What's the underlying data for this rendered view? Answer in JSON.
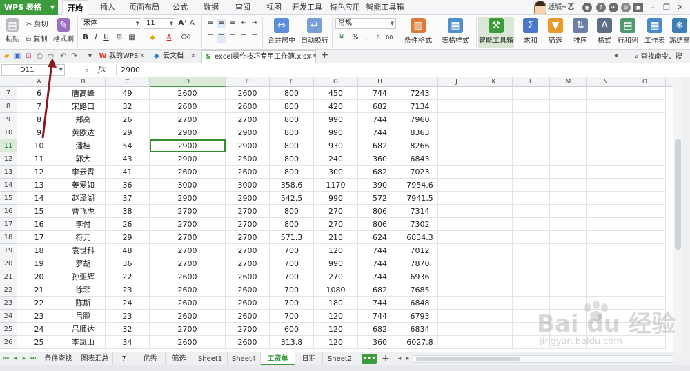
{
  "app": {
    "name": "WPS 表格"
  },
  "menu": [
    "开始",
    "插入",
    "页面布局",
    "公式",
    "数据",
    "审阅",
    "视图",
    "开发工具",
    "特色应用",
    "智能工具箱"
  ],
  "active_menu": 0,
  "user": {
    "name": "迷城~恋"
  },
  "ribbon": {
    "paste": "粘贴",
    "cut": "剪切",
    "copy": "复制",
    "format_painter": "格式刷",
    "font_name": "宋体",
    "font_size": "11",
    "merge_center": "合并居中",
    "wrap_text": "自动换行",
    "number_format": "常规",
    "cond_format": "条件格式",
    "table_style": "表格样式",
    "smart_toolbox": "智能工具箱",
    "sum": "求和",
    "filter": "筛选",
    "sort": "排序",
    "format": "格式",
    "row_col": "行和列",
    "worksheet": "工作表",
    "freeze": "冻结窗"
  },
  "tabs": [
    {
      "label": "我的WPS",
      "icon": "W",
      "color": "#d23b2f"
    },
    {
      "label": "云文档",
      "icon": "◆",
      "color": "#2f7fd2"
    },
    {
      "label": "excel操作技巧专用工作簿.xlsx *",
      "icon": "S",
      "color": "#3d9a3d"
    }
  ],
  "command_search": "查找命令、搜",
  "name_box": "D11",
  "formula": "2900",
  "columns": [
    "A",
    "B",
    "C",
    "D",
    "E",
    "F",
    "G",
    "H",
    "I",
    "J",
    "K",
    "L",
    "M",
    "N",
    "O"
  ],
  "selected_column": "D",
  "selected_row": "11",
  "rows": [
    {
      "r": "7",
      "cells": [
        "6",
        "唐高峰",
        "49",
        "2600",
        "2600",
        "800",
        "450",
        "744",
        "7243"
      ]
    },
    {
      "r": "8",
      "cells": [
        "7",
        "宋路口",
        "32",
        "2600",
        "2600",
        "800",
        "420",
        "682",
        "7134"
      ]
    },
    {
      "r": "9",
      "cells": [
        "8",
        "郑高",
        "26",
        "2700",
        "2700",
        "800",
        "990",
        "744",
        "7960"
      ]
    },
    {
      "r": "10",
      "cells": [
        "9",
        "黄欧达",
        "29",
        "2900",
        "2900",
        "800",
        "990",
        "744",
        "8363"
      ]
    },
    {
      "r": "11",
      "cells": [
        "10",
        "潘桂",
        "54",
        "2900",
        "2900",
        "800",
        "930",
        "682",
        "8266"
      ]
    },
    {
      "r": "12",
      "cells": [
        "11",
        "郭大",
        "43",
        "2900",
        "2500",
        "800",
        "240",
        "360",
        "6843"
      ]
    },
    {
      "r": "13",
      "cells": [
        "12",
        "李云霄",
        "41",
        "2600",
        "2600",
        "800",
        "300",
        "682",
        "7023"
      ]
    },
    {
      "r": "14",
      "cells": [
        "13",
        "姜爱如",
        "36",
        "3000",
        "3000",
        "358.6",
        "1170",
        "390",
        "7954.6"
      ]
    },
    {
      "r": "15",
      "cells": [
        "14",
        "赵泽湖",
        "37",
        "2900",
        "2900",
        "542.5",
        "990",
        "572",
        "7941.5"
      ]
    },
    {
      "r": "16",
      "cells": [
        "15",
        "曹飞虎",
        "38",
        "2700",
        "2700",
        "800",
        "270",
        "806",
        "7314"
      ]
    },
    {
      "r": "17",
      "cells": [
        "16",
        "李付",
        "26",
        "2700",
        "2700",
        "800",
        "270",
        "806",
        "7302"
      ]
    },
    {
      "r": "18",
      "cells": [
        "17",
        "符元",
        "29",
        "2700",
        "2700",
        "571.3",
        "210",
        "624",
        "6834.3"
      ]
    },
    {
      "r": "19",
      "cells": [
        "18",
        "袁世科",
        "48",
        "2700",
        "2700",
        "700",
        "120",
        "744",
        "7012"
      ]
    },
    {
      "r": "20",
      "cells": [
        "19",
        "罗胡",
        "36",
        "2700",
        "2700",
        "700",
        "990",
        "744",
        "7870"
      ]
    },
    {
      "r": "21",
      "cells": [
        "20",
        "孙亚辉",
        "22",
        "2600",
        "2600",
        "700",
        "270",
        "744",
        "6936"
      ]
    },
    {
      "r": "22",
      "cells": [
        "21",
        "徐菲",
        "23",
        "2600",
        "2600",
        "700",
        "1080",
        "682",
        "7685"
      ]
    },
    {
      "r": "23",
      "cells": [
        "22",
        "陈斯",
        "24",
        "2600",
        "2600",
        "700",
        "180",
        "744",
        "6848"
      ]
    },
    {
      "r": "24",
      "cells": [
        "23",
        "吕鹏",
        "23",
        "2600",
        "2600",
        "700",
        "120",
        "744",
        "6793"
      ]
    },
    {
      "r": "25",
      "cells": [
        "24",
        "吕顺达",
        "32",
        "2700",
        "2700",
        "600",
        "120",
        "682",
        "6834"
      ]
    },
    {
      "r": "26",
      "cells": [
        "25",
        "李岚山",
        "34",
        "2600",
        "2600",
        "313.8",
        "120",
        "360",
        "6027.8"
      ]
    }
  ],
  "sheets": [
    "条件查找",
    "图表汇总",
    "7",
    "优秀",
    "筛选",
    "Sheet1",
    "Sheet4",
    "工资单",
    "日期",
    "Sheet2"
  ],
  "active_sheet": "工资单",
  "watermark": {
    "brand": "Bai du 经验",
    "url": "jingyan.baidu.com"
  },
  "colors": {
    "accent": "#3d9a3d",
    "arrow": "#8b1a1a"
  }
}
